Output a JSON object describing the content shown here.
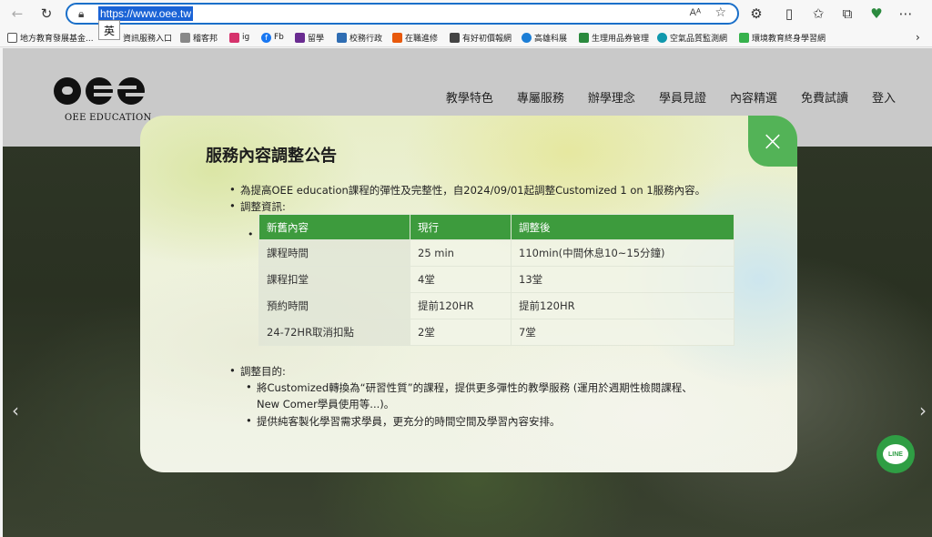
{
  "browser": {
    "url": "https://www.oee.tw",
    "reader_label": "Aᴬ",
    "ime_label": "英",
    "bookmarks": [
      {
        "label": "地方教育發展基金...",
        "color": "#555555"
      },
      {
        "label": "資訊服務入口",
        "color": "#4a7bd0"
      },
      {
        "label": "稽客邦",
        "color": "#666666"
      },
      {
        "label": "ig",
        "color": "#d6336c"
      },
      {
        "label": "Fb",
        "color": "#1877f2"
      },
      {
        "label": "留學",
        "color": "#6a2c91"
      },
      {
        "label": "校務行政",
        "color": "#2f6db3"
      },
      {
        "label": "在職進修",
        "color": "#e8590c"
      },
      {
        "label": "有好初價報網",
        "color": "#444444"
      },
      {
        "label": "高雄科展",
        "color": "#1c7ed6"
      },
      {
        "label": "生理用品券管理",
        "color": "#2b8a3e"
      },
      {
        "label": "空氣品質監測網",
        "color": "#1098ad"
      },
      {
        "label": "環境教育終身學習網",
        "color": "#37b24d"
      }
    ]
  },
  "site": {
    "logo_text": "OEE EDUCATION",
    "nav": [
      "教學特色",
      "專屬服務",
      "辦學理念",
      "學員見證",
      "內容精選",
      "免費試讀",
      "登入"
    ]
  },
  "modal": {
    "title": "服務內容調整公告",
    "intro": "為提高OEE education課程的彈性及完整性，自2024/09/01起調整Customized 1 on 1服務內容。",
    "adjust_label": "調整資訊:",
    "table": {
      "headers": [
        "新舊內容",
        "現行",
        "調整後"
      ],
      "rows": [
        [
          "課程時間",
          "25 min",
          "110min(中間休息10~15分鐘)"
        ],
        [
          "課程扣堂",
          "4堂",
          "13堂"
        ],
        [
          "預約時間",
          "提前120HR",
          "提前120HR"
        ],
        [
          "24-72HR取消扣點",
          "2堂",
          "7堂"
        ]
      ]
    },
    "purpose_label": "調整目的:",
    "purpose_items": [
      "將Customized轉換為“研習性質”的課程，提供更多彈性的教學服務 (運用於週期性檢閱課程、",
      "New Comer學員使用等...)。",
      "提供純客製化學習需求學員，更充分的時間空間及學習內容安排。"
    ],
    "close_icon": "×"
  },
  "colors": {
    "accent_green": "#53b357",
    "table_header": "#3d9b3d",
    "line_green": "#2f9e44"
  }
}
